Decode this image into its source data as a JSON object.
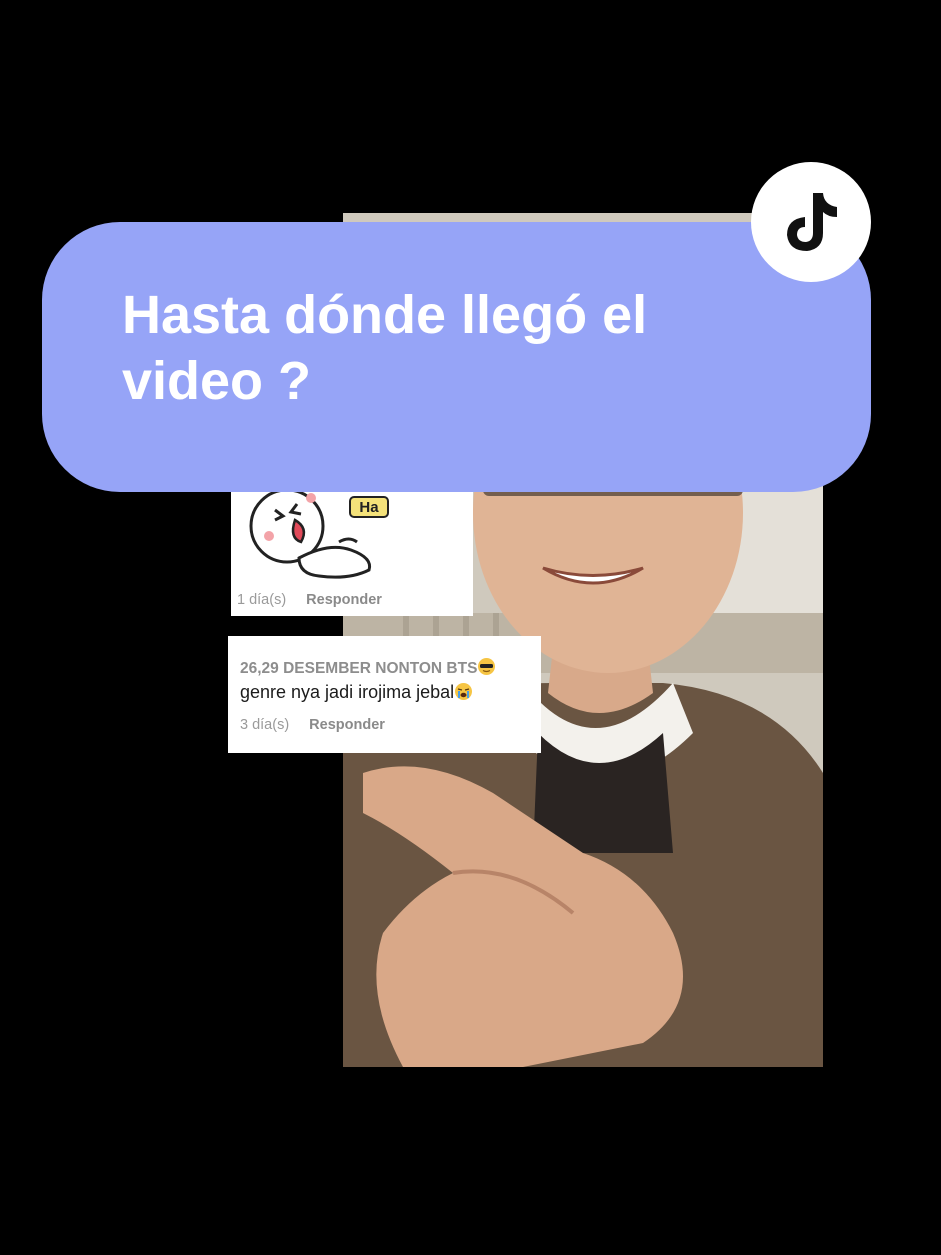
{
  "question": {
    "text": "Hasta dónde llegó el video ?"
  },
  "tiktok_badge": {
    "icon": "tiktok-logo-icon"
  },
  "comments": [
    {
      "sticker_icon": "laughing-sticker-icon",
      "sticker_text": "Ha",
      "time": "1 día(s)",
      "reply_label": "Responder"
    },
    {
      "username": "26,29 DESEMBER NONTON BTS",
      "username_emoji": "sunglasses-emoji-icon",
      "text": "genre nya jadi irojima jebal",
      "text_emoji": "crying-emoji-icon",
      "time": "3 día(s)",
      "reply_label": "Responder"
    }
  ],
  "colors": {
    "background": "#000000",
    "bubble": "#96a4f7",
    "bubble_text": "#ffffff",
    "badge_bg": "#ffffff",
    "card_bg": "#ffffff"
  }
}
